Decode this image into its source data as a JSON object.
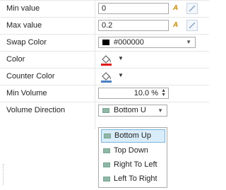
{
  "rows": [
    {
      "label": "Min value",
      "value": "0"
    },
    {
      "label": "Max value",
      "value": "0.2"
    },
    {
      "label": "Swap Color",
      "value": "#000000"
    },
    {
      "label": "Color"
    },
    {
      "label": "Counter Color"
    },
    {
      "label": "Min Volume",
      "value": "10.0 %"
    },
    {
      "label": "Volume Direction",
      "value": "Bottom U"
    }
  ],
  "icons": {
    "formula": "A",
    "arrow": "▼",
    "spin_up": "▲",
    "spin_down": "▼"
  },
  "colors": {
    "swap": "#000000",
    "color_bar": "#e11b1b",
    "counter_bar": "#4a7ec2"
  },
  "dropdown": {
    "options": [
      "Bottom Up",
      "Top Down",
      "Right To Left",
      "Left To Right"
    ],
    "selected": "Bottom Up"
  }
}
